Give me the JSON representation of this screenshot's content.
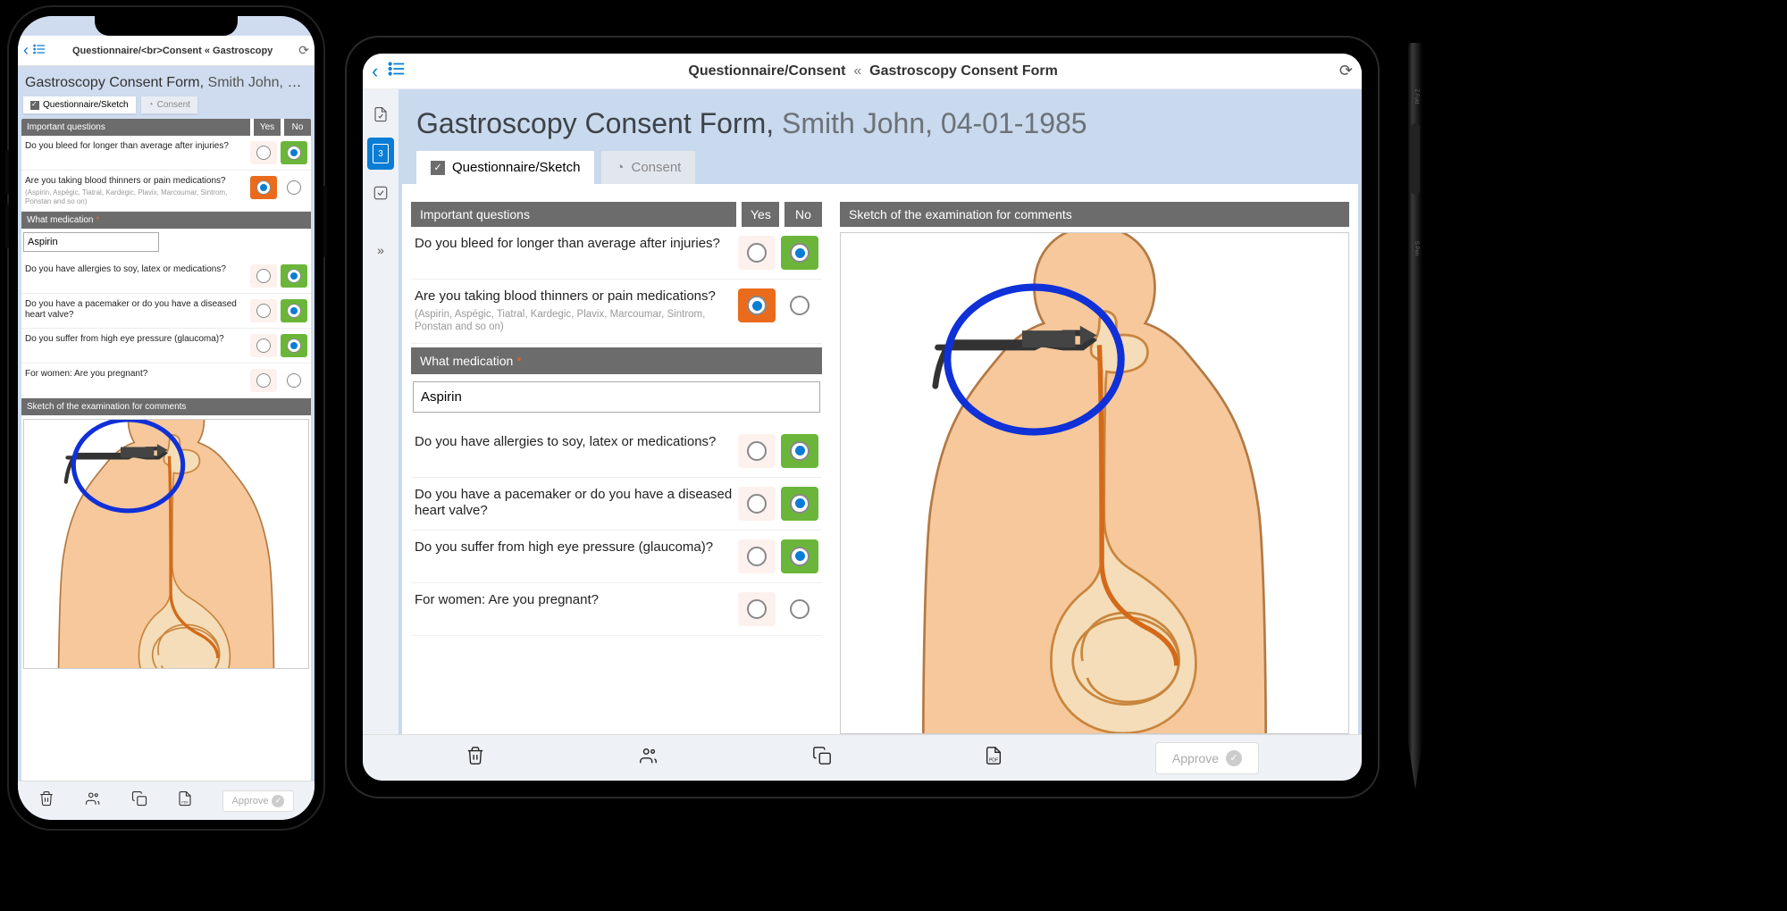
{
  "breadcrumb_phone": "Questionnaire/<br>Consent « Gastroscopy",
  "breadcrumb_tablet_a": "Questionnaire/Consent",
  "breadcrumb_tablet_sep": "«",
  "breadcrumb_tablet_b": "Gastroscopy Consent Form",
  "form_title": "Gastroscopy Consent Form",
  "patient_name": "Smith John",
  "patient_dob": "04-01-1985",
  "phone_title_tail": "Smith John, 04-01…",
  "tabs": {
    "questionnaire": "Questionnaire/Sketch",
    "consent": "Consent"
  },
  "headers": {
    "important": "Important questions",
    "yes": "Yes",
    "no": "No",
    "medication": "What medication",
    "required": "*",
    "sketch": "Sketch of the examination for comments"
  },
  "questions": [
    {
      "text": "Do you bleed for longer than average after injuries?",
      "hint": "",
      "answer": "no"
    },
    {
      "text": "Are you taking blood thinners or pain medications?",
      "hint": "(Aspirin, Aspégic, Tiatral, Kardegic, Plavix, Marcoumar, Sintrom, Ponstan and so on)",
      "answer": "yes"
    },
    {
      "text": "Do you have allergies to soy, latex or medications?",
      "hint": "",
      "answer": "no"
    },
    {
      "text": "Do you have a pacemaker or do you have a diseased heart valve?",
      "hint": "",
      "answer": "no"
    },
    {
      "text": "Do you suffer from high eye pressure (glaucoma)?",
      "hint": "",
      "answer": "no"
    },
    {
      "text": "For women: Are you pregnant?",
      "hint": "",
      "answer": ""
    }
  ],
  "medication_value": "Aspirin",
  "approve_label": "Approve",
  "sidebar_badge": "3"
}
